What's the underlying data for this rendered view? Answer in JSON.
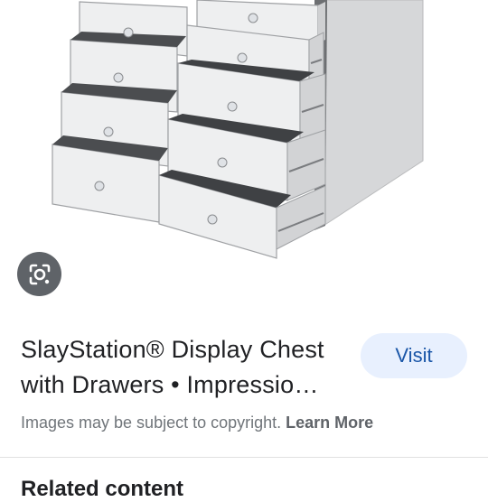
{
  "result": {
    "title": "SlayStation® Display Chest with Drawers • Impressio…",
    "visit_label": "Visit"
  },
  "notice": {
    "text": "Images may be subject to copyright.",
    "link_label": "Learn More"
  },
  "related": {
    "heading": "Related content"
  },
  "icons": {
    "lens": "google-lens-icon"
  },
  "colors": {
    "visit_bg": "#e8f0fe",
    "visit_text": "#1a56a8",
    "lens_bg": "#5f6368"
  }
}
